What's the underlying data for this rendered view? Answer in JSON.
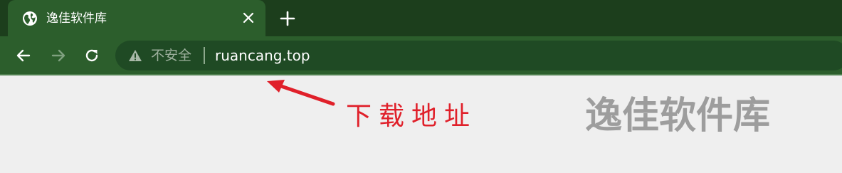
{
  "tab": {
    "title": "逸佳软件库",
    "favicon": "globe-icon",
    "close_icon": "close-icon"
  },
  "new_tab_icon": "plus-icon",
  "nav": {
    "back_icon": "arrow-left-icon",
    "forward_icon": "arrow-right-icon",
    "reload_icon": "reload-icon"
  },
  "omnibox": {
    "security_icon": "warning-triangle-icon",
    "security_label": "不安全",
    "url": "ruancang.top"
  },
  "annotation": {
    "label": "下载地址",
    "color": "#e0202a"
  },
  "watermark": {
    "text": "逸佳软件库"
  },
  "colors": {
    "tabstrip": "#1c3e1c",
    "toolbar": "#2c5e2c",
    "omnibox": "#1f4a24",
    "page": "#efefef"
  }
}
